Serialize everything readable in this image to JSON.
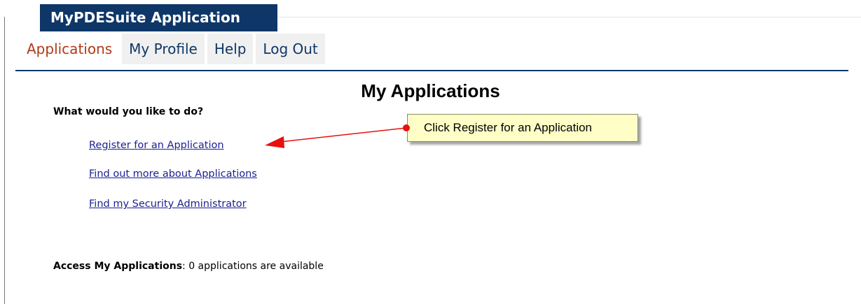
{
  "app": {
    "title": "MyPDESuite Application"
  },
  "nav": {
    "items": [
      {
        "label": "Applications",
        "active": true
      },
      {
        "label": "My Profile"
      },
      {
        "label": "Help"
      },
      {
        "label": "Log Out"
      }
    ]
  },
  "page": {
    "title": "My Applications",
    "prompt": "What would you like to do?",
    "links": [
      {
        "label": "Register for an Application"
      },
      {
        "label": "Find out more about Applications"
      },
      {
        "label": "Find my Security Administrator"
      }
    ],
    "access": {
      "label": "Access My Applications",
      "separator": ":",
      "status": "0 applications are available"
    }
  },
  "callout": {
    "text": "Click Register for an Application"
  },
  "colors": {
    "banner": "#0e3768",
    "nav_active": "#b03a17",
    "link": "#1a1f8f",
    "callout_bg": "#fffec7",
    "arrow": "#e8100e"
  }
}
